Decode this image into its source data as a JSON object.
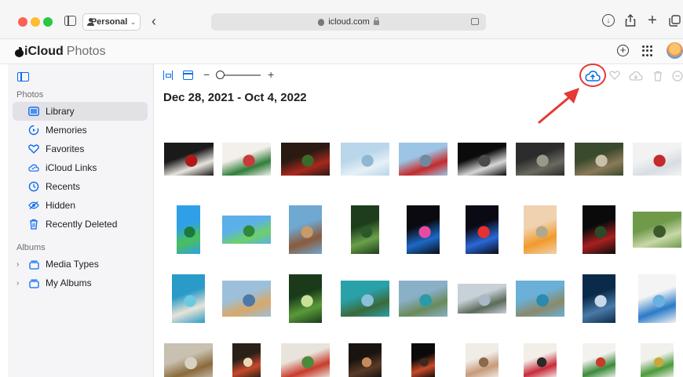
{
  "browser": {
    "profile": "Personal",
    "url": "icloud.com"
  },
  "app": {
    "brand": "iCloud",
    "product": "Photos"
  },
  "sidebar": {
    "photos_header": "Photos",
    "items": [
      {
        "label": "Library",
        "icon": "library-icon",
        "active": true
      },
      {
        "label": "Memories",
        "icon": "memories-icon"
      },
      {
        "label": "Favorites",
        "icon": "heart-icon"
      },
      {
        "label": "iCloud Links",
        "icon": "cloud-link-icon"
      },
      {
        "label": "Recents",
        "icon": "clock-icon"
      },
      {
        "label": "Hidden",
        "icon": "eye-slash-icon"
      },
      {
        "label": "Recently Deleted",
        "icon": "trash-icon"
      }
    ],
    "albums_header": "Albums",
    "albums": [
      {
        "label": "Media Types",
        "icon": "album-stack-icon"
      },
      {
        "label": "My Albums",
        "icon": "album-stack-icon"
      }
    ]
  },
  "main": {
    "date_range": "Dec 28, 2021 - Oct 4, 2022",
    "zoom_level": 0.08
  },
  "colors": {
    "accent": "#0a6cf2",
    "highlight_ring": "#e53935"
  },
  "photos": [
    {
      "row": 0,
      "desc": "dog-in-santa-outfit",
      "colors": [
        "#1a1a1a",
        "#e8e4de",
        "#b01818"
      ]
    },
    {
      "row": 0,
      "desc": "christmas-cookies",
      "colors": [
        "#f3f0ec",
        "#2f7d3a",
        "#c93b3b"
      ]
    },
    {
      "row": 0,
      "desc": "christmas-ornaments",
      "colors": [
        "#2a1a12",
        "#a8281e",
        "#3b6b2a"
      ]
    },
    {
      "row": 0,
      "desc": "winter-sky",
      "colors": [
        "#b9d6ea",
        "#e6f0f6",
        "#8fb7d4"
      ]
    },
    {
      "row": 0,
      "desc": "red-lantern-tree",
      "colors": [
        "#9cc4e4",
        "#c52a2a",
        "#6f8aa0"
      ]
    },
    {
      "row": 0,
      "desc": "dandelion-macro",
      "colors": [
        "#0b0b0b",
        "#d7d7d7",
        "#4a4a4a"
      ]
    },
    {
      "row": 0,
      "desc": "forest-path",
      "colors": [
        "#2c2c2c",
        "#6a6a60",
        "#9a9888"
      ]
    },
    {
      "row": 0,
      "desc": "reindeer",
      "colors": [
        "#3a4a2c",
        "#8b7a5a",
        "#c8c0a8"
      ]
    },
    {
      "row": 0,
      "desc": "cable-car",
      "colors": [
        "#f2f2f2",
        "#d8dde2",
        "#c52a2a"
      ]
    },
    {
      "row": 1,
      "desc": "green-hills-wallpaper",
      "colors": [
        "#2fa0e8",
        "#4bbf5a",
        "#1a7a3a"
      ]
    },
    {
      "row": 1,
      "desc": "green-hills-wide",
      "colors": [
        "#5bb0e8",
        "#6ed06a",
        "#2c8a3a"
      ]
    },
    {
      "row": 1,
      "desc": "desert-rocks",
      "colors": [
        "#6fa8d0",
        "#8a5a3a",
        "#c89a6a"
      ]
    },
    {
      "row": 1,
      "desc": "motion-green",
      "colors": [
        "#1d3d1c",
        "#6aa04a",
        "#2a5a2a"
      ]
    },
    {
      "row": 1,
      "desc": "abstract-dark",
      "colors": [
        "#0a0a10",
        "#1c6ac8",
        "#e84aa0"
      ]
    },
    {
      "row": 1,
      "desc": "bubble-dark",
      "colors": [
        "#0a0a14",
        "#2a68d8",
        "#e83030"
      ]
    },
    {
      "row": 1,
      "desc": "sunset-minimal",
      "colors": [
        "#f0d2b0",
        "#f29a2a",
        "#b0a88a"
      ]
    },
    {
      "row": 1,
      "desc": "red-flower-dark",
      "colors": [
        "#0a0a0a",
        "#a82020",
        "#2a4a2a"
      ]
    },
    {
      "row": 1,
      "desc": "bamboo",
      "colors": [
        "#6f9a4a",
        "#c8d8a8",
        "#3a5a2a"
      ]
    },
    {
      "row": 2,
      "desc": "beach-aerial",
      "colors": [
        "#2a9ac8",
        "#e8e4d8",
        "#6acbe0"
      ]
    },
    {
      "row": 2,
      "desc": "lifeguard-tower",
      "colors": [
        "#9cc0dc",
        "#d8a868",
        "#4a7aa8"
      ]
    },
    {
      "row": 2,
      "desc": "forest-canopy",
      "colors": [
        "#1a3a1a",
        "#5a9a3a",
        "#c8e098"
      ]
    },
    {
      "row": 2,
      "desc": "island-lagoon",
      "colors": [
        "#2aa0a8",
        "#3a6a3a",
        "#8ac0d8"
      ]
    },
    {
      "row": 2,
      "desc": "cliffs-sea",
      "colors": [
        "#8ab0c8",
        "#6a8a5a",
        "#2a9aa8"
      ]
    },
    {
      "row": 2,
      "desc": "mountains-lake",
      "colors": [
        "#c8d0d8",
        "#5a6a5a",
        "#aab8c8"
      ]
    },
    {
      "row": 2,
      "desc": "rock-sea",
      "colors": [
        "#6ab0d8",
        "#8a8a6a",
        "#2a8ab0"
      ]
    },
    {
      "row": 2,
      "desc": "night-sea",
      "colors": [
        "#0a2a4a",
        "#4a7aa8",
        "#c8d8e8"
      ]
    },
    {
      "row": 2,
      "desc": "blue-flowers",
      "colors": [
        "#f4f4f4",
        "#2a7ac8",
        "#6ab0e0"
      ]
    },
    {
      "row": 3,
      "desc": "giraffes",
      "colors": [
        "#c8c0b0",
        "#8a6a3a",
        "#d8d0c0"
      ]
    },
    {
      "row": 3,
      "desc": "food-bowl",
      "colors": [
        "#2a2018",
        "#c84a2a",
        "#e8d8b8"
      ]
    },
    {
      "row": 3,
      "desc": "salad-plate",
      "colors": [
        "#e8e4dc",
        "#c83a2a",
        "#4a8a3a"
      ]
    },
    {
      "row": 3,
      "desc": "grill-food",
      "colors": [
        "#1a1410",
        "#5a3a28",
        "#c88a5a"
      ]
    },
    {
      "row": 3,
      "desc": "dark-drink",
      "colors": [
        "#0a0a0a",
        "#c84a2a",
        "#3a2a20"
      ]
    },
    {
      "row": 3,
      "desc": "hand-pouring",
      "colors": [
        "#f0ece6",
        "#c89a7a",
        "#8a6a4a"
      ]
    },
    {
      "row": 3,
      "desc": "red-cocktail",
      "colors": [
        "#f2eee8",
        "#c82a3a",
        "#2a2a2a"
      ]
    },
    {
      "row": 3,
      "desc": "fruit-dessert",
      "colors": [
        "#f4f2ee",
        "#3a8a3a",
        "#c83a2a"
      ]
    },
    {
      "row": 3,
      "desc": "salad-bowl",
      "colors": [
        "#f2f0ea",
        "#4a9a3a",
        "#c8a83a"
      ]
    }
  ]
}
